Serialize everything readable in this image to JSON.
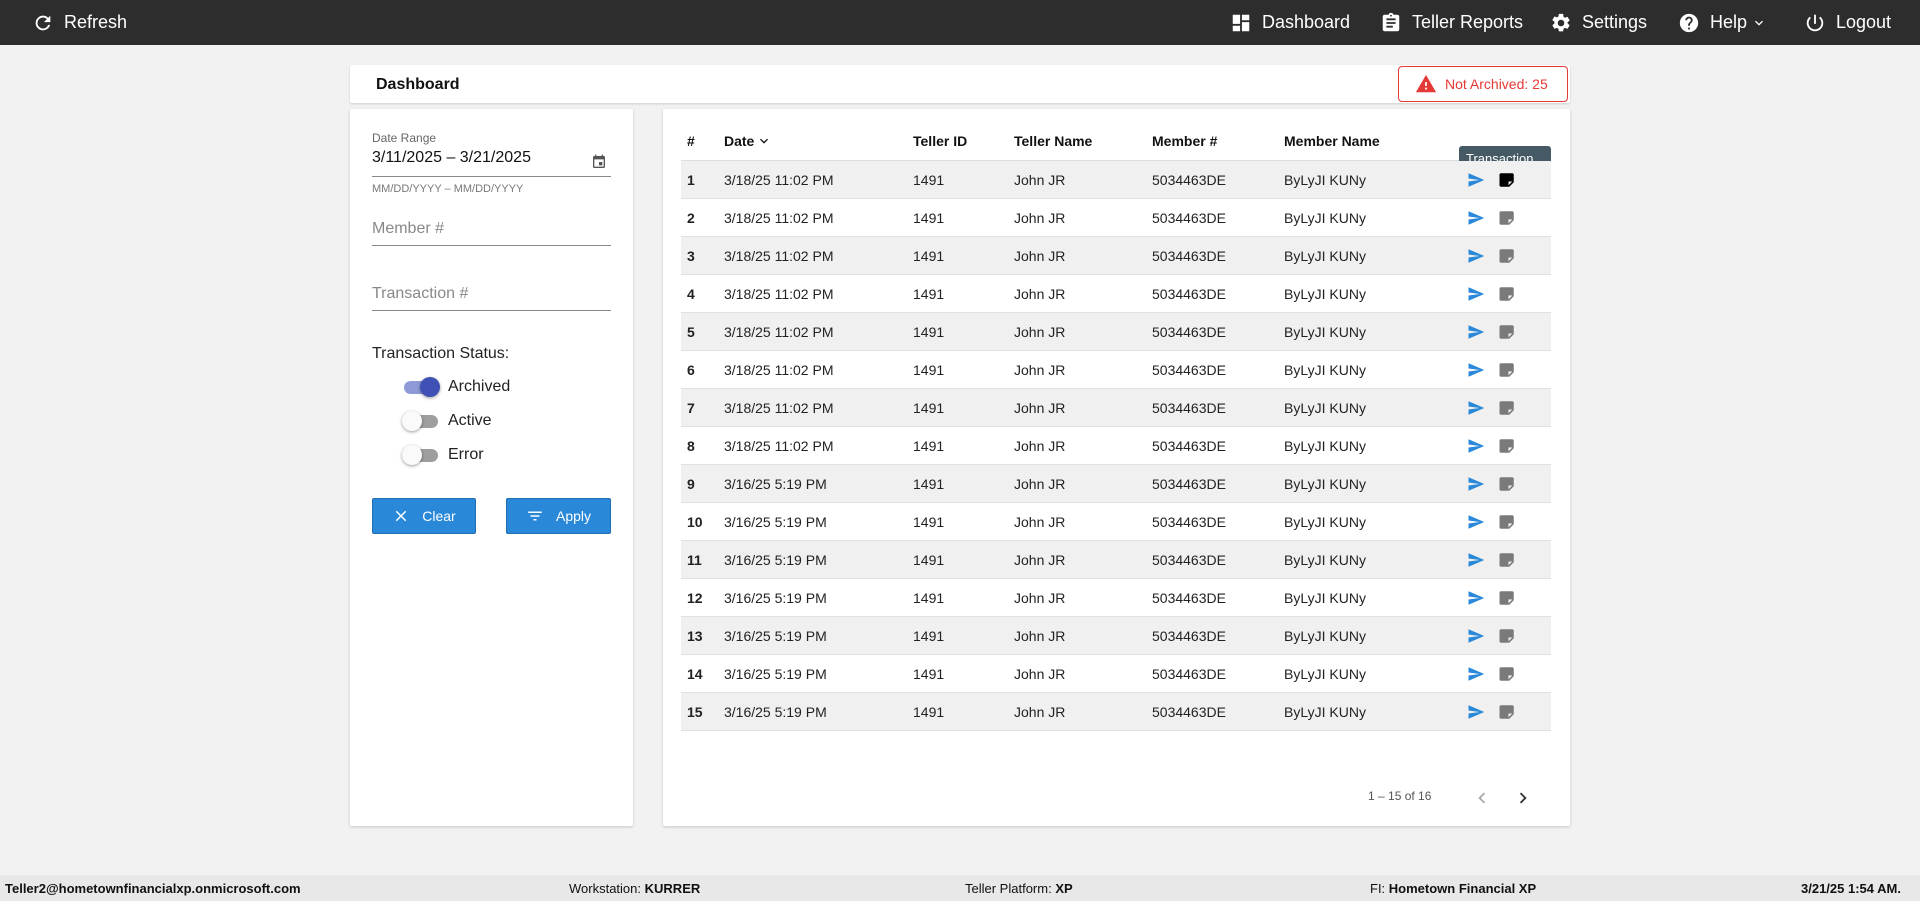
{
  "topbar": {
    "refresh": "Refresh",
    "dashboard": "Dashboard",
    "teller_reports": "Teller Reports",
    "settings": "Settings",
    "help": "Help",
    "logout": "Logout"
  },
  "header": {
    "title": "Dashboard",
    "alert": "Not Archived: 25",
    "alert_color": "#e53935"
  },
  "filters": {
    "date_range_label": "Date Range",
    "date_range_value": "3/11/2025 – 3/21/2025",
    "date_range_hint": "MM/DD/YYYY – MM/DD/YYYY",
    "member_placeholder": "Member #",
    "transaction_placeholder": "Transaction #",
    "status_title": "Transaction Status:",
    "statuses": [
      {
        "label": "Archived",
        "on": true
      },
      {
        "label": "Active",
        "on": false
      },
      {
        "label": "Error",
        "on": false
      }
    ],
    "clear_label": "Clear",
    "apply_label": "Apply"
  },
  "table": {
    "columns": [
      "#",
      "Date",
      "Teller ID",
      "Teller Name",
      "Member #",
      "Member Name"
    ],
    "rows": [
      {
        "n": "1",
        "date": "3/18/25 11:02 PM",
        "teller_id": "1491",
        "teller_name": "John JR",
        "member": "5034463DE",
        "member_name": "ByLyJI KUNy"
      },
      {
        "n": "2",
        "date": "3/18/25 11:02 PM",
        "teller_id": "1491",
        "teller_name": "John JR",
        "member": "5034463DE",
        "member_name": "ByLyJI KUNy"
      },
      {
        "n": "3",
        "date": "3/18/25 11:02 PM",
        "teller_id": "1491",
        "teller_name": "John JR",
        "member": "5034463DE",
        "member_name": "ByLyJI KUNy"
      },
      {
        "n": "4",
        "date": "3/18/25 11:02 PM",
        "teller_id": "1491",
        "teller_name": "John JR",
        "member": "5034463DE",
        "member_name": "ByLyJI KUNy"
      },
      {
        "n": "5",
        "date": "3/18/25 11:02 PM",
        "teller_id": "1491",
        "teller_name": "John JR",
        "member": "5034463DE",
        "member_name": "ByLyJI KUNy"
      },
      {
        "n": "6",
        "date": "3/18/25 11:02 PM",
        "teller_id": "1491",
        "teller_name": "John JR",
        "member": "5034463DE",
        "member_name": "ByLyJI KUNy"
      },
      {
        "n": "7",
        "date": "3/18/25 11:02 PM",
        "teller_id": "1491",
        "teller_name": "John JR",
        "member": "5034463DE",
        "member_name": "ByLyJI KUNy"
      },
      {
        "n": "8",
        "date": "3/18/25 11:02 PM",
        "teller_id": "1491",
        "teller_name": "John JR",
        "member": "5034463DE",
        "member_name": "ByLyJI KUNy"
      },
      {
        "n": "9",
        "date": "3/16/25 5:19 PM",
        "teller_id": "1491",
        "teller_name": "John JR",
        "member": "5034463DE",
        "member_name": "ByLyJI KUNy"
      },
      {
        "n": "10",
        "date": "3/16/25 5:19 PM",
        "teller_id": "1491",
        "teller_name": "John JR",
        "member": "5034463DE",
        "member_name": "ByLyJI KUNy"
      },
      {
        "n": "11",
        "date": "3/16/25 5:19 PM",
        "teller_id": "1491",
        "teller_name": "John JR",
        "member": "5034463DE",
        "member_name": "ByLyJI KUNy"
      },
      {
        "n": "12",
        "date": "3/16/25 5:19 PM",
        "teller_id": "1491",
        "teller_name": "John JR",
        "member": "5034463DE",
        "member_name": "ByLyJI KUNy"
      },
      {
        "n": "13",
        "date": "3/16/25 5:19 PM",
        "teller_id": "1491",
        "teller_name": "John JR",
        "member": "5034463DE",
        "member_name": "ByLyJI KUNy"
      },
      {
        "n": "14",
        "date": "3/16/25 5:19 PM",
        "teller_id": "1491",
        "teller_name": "John JR",
        "member": "5034463DE",
        "member_name": "ByLyJI KUNy"
      },
      {
        "n": "15",
        "date": "3/16/25 5:19 PM",
        "teller_id": "1491",
        "teller_name": "John JR",
        "member": "5034463DE",
        "member_name": "ByLyJI KUNy"
      }
    ],
    "tooltip": "Transaction Log",
    "pagination": "1 – 15 of 16",
    "accent_color": "#2a88d8"
  },
  "footer": {
    "user": "Teller2@hometownfinancialxp.onmicrosoft.com",
    "workstation_label": "Workstation:",
    "workstation": "KURRER",
    "platform_label": "Teller Platform:",
    "platform": "XP",
    "fi_label": "FI:",
    "fi": "Hometown Financial XP",
    "datetime": "3/21/25 1:54 AM."
  }
}
